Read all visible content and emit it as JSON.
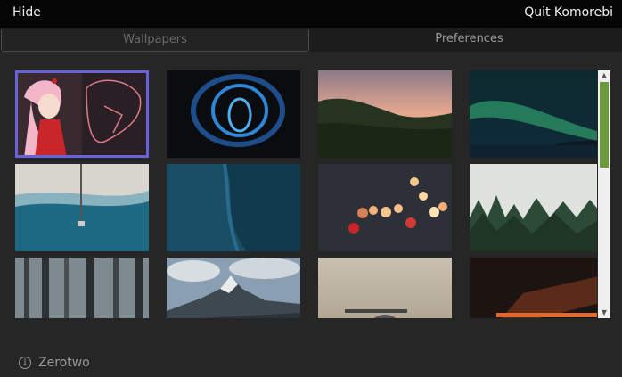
{
  "topbar": {
    "hide_label": "Hide",
    "quit_label": "Quit Komorebi"
  },
  "tabs": [
    {
      "label": "Wallpapers",
      "active": true
    },
    {
      "label": "Preferences",
      "active": false
    }
  ],
  "wallpapers": [
    {
      "name": "anime-girl",
      "selected": true
    },
    {
      "name": "blue-light-swirl",
      "selected": false
    },
    {
      "name": "forest-sunset",
      "selected": false
    },
    {
      "name": "aurora",
      "selected": false
    },
    {
      "name": "beach-aerial",
      "selected": false
    },
    {
      "name": "blue-water",
      "selected": false
    },
    {
      "name": "bokeh-lights",
      "selected": false
    },
    {
      "name": "foggy-forest",
      "selected": false
    },
    {
      "name": "misty-woods",
      "selected": false
    },
    {
      "name": "snowy-mountain",
      "selected": false
    },
    {
      "name": "beige-horizon",
      "selected": false
    },
    {
      "name": "orange-lights",
      "selected": false
    }
  ],
  "footer": {
    "info_text": "Zerotwo"
  }
}
